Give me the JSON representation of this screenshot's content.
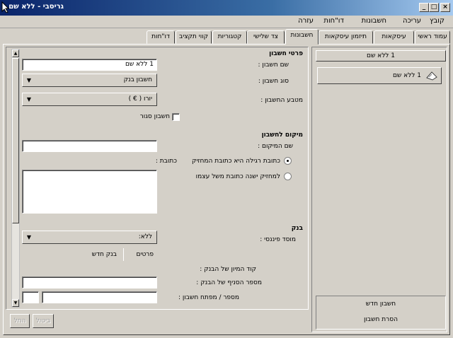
{
  "window": {
    "title": "גריסבי - ללא שם"
  },
  "menu": [
    "קובץ",
    "עריכה",
    "חשבונות",
    "דו\"חות",
    "עזרה"
  ],
  "tabs": [
    "עמוד ראשי",
    "עיסקאות",
    "תיזמון עיסקאות",
    "חשבונות",
    "צד שלישי",
    "קטגוריות",
    "קווי תקציב",
    "דו\"חות"
  ],
  "left_panel": {
    "header": "1 ללא שם",
    "tree_item": "1 ללא שם",
    "new_account_button": "חשבון חדש",
    "remove_account_button": "הסרת חשבון"
  },
  "account_details": {
    "section_title": "פרטי חשבון",
    "name_label": "שם חשבון :",
    "name_value": "1 ללא שם",
    "type_label": "סוג חשבון :",
    "type_value": "חשבון בנק",
    "currency_label": "מטבע החשבון :",
    "currency_value": "יורו ( € )",
    "closed_label": "חשבון סגור"
  },
  "location": {
    "section_title": "מיקום לחשבון",
    "place_name_label": "שם המיקום :",
    "place_name_value": "",
    "radio_same": "כתובת רגילה היא כתובת המחזיק",
    "radio_other": "למחזיק ישנה כתובת משל עצמו",
    "address_label": "כתובת :",
    "address_value": ""
  },
  "bank": {
    "section_title": "בנק",
    "institution_label": "מוסד פיננסי :",
    "institution_value": "ללא:",
    "details_link": "פרטים",
    "new_bank_link": "בנק חדש",
    "routing_label": "קוד המיון של הבנק :",
    "branch_label": "מספר הסניף של הבנק :",
    "account_number_label": "מספר / מפתח חשבון :",
    "branch_value": "",
    "account_number_value": "",
    "account_key_value": ""
  },
  "bottom_buttons": {
    "cancel": "ביטול",
    "apply": "החל"
  }
}
